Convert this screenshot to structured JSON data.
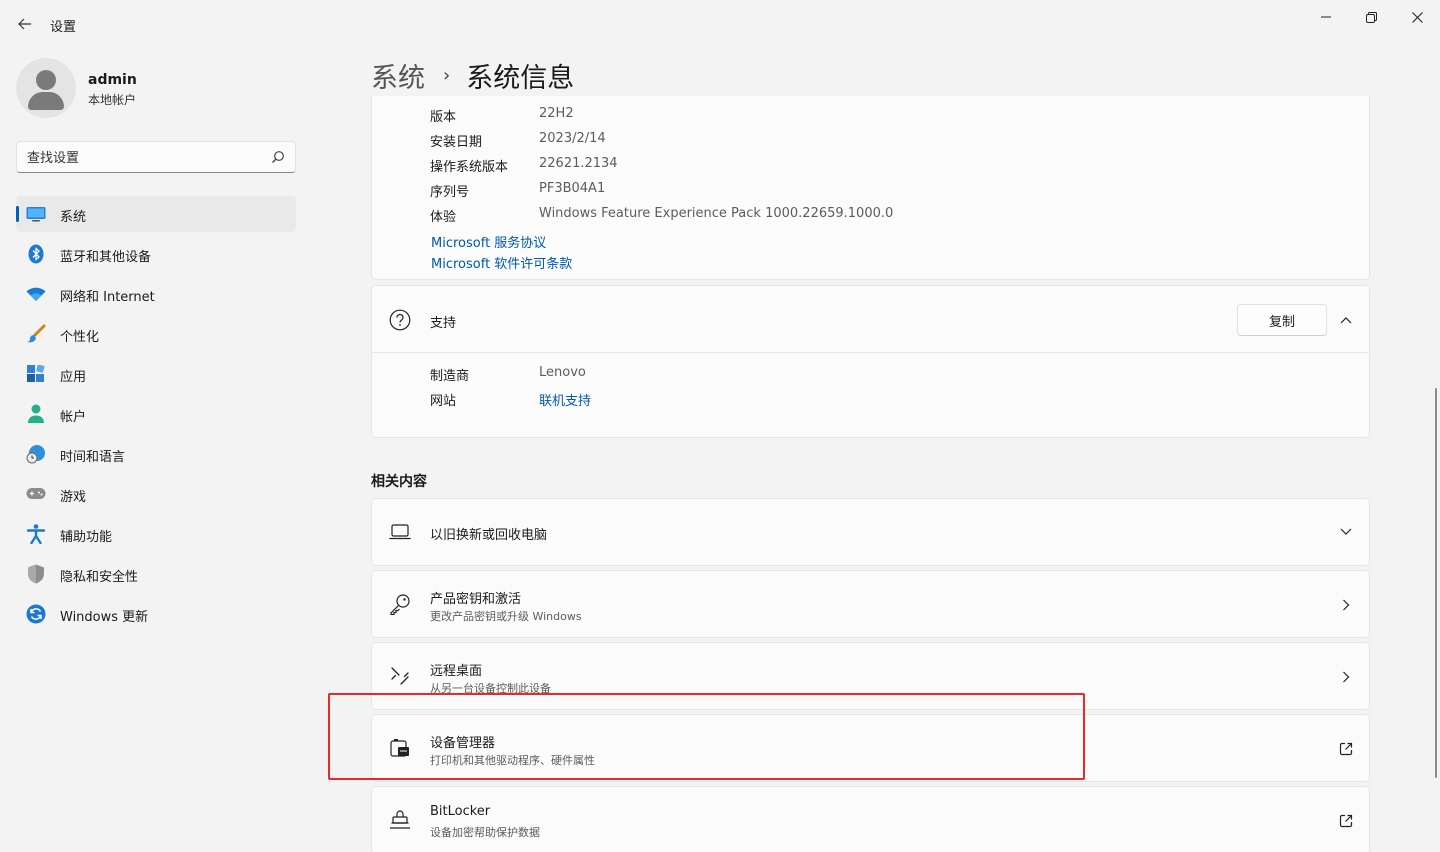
{
  "window": {
    "title": "设置",
    "back_icon": "arrow-left-icon",
    "minimize_icon": "minimize-icon",
    "maximize_icon": "restore-icon",
    "close_icon": "close-icon"
  },
  "profile": {
    "name": "admin",
    "account_type": "本地帐户"
  },
  "search": {
    "placeholder": "查找设置",
    "icon": "search-icon"
  },
  "sidebar": {
    "items": [
      {
        "label": "系统",
        "icon": "monitor-icon",
        "active": true
      },
      {
        "label": "蓝牙和其他设备",
        "icon": "bluetooth-icon"
      },
      {
        "label": "网络和 Internet",
        "icon": "wifi-icon"
      },
      {
        "label": "个性化",
        "icon": "paintbrush-icon"
      },
      {
        "label": "应用",
        "icon": "apps-icon"
      },
      {
        "label": "帐户",
        "icon": "person-icon"
      },
      {
        "label": "时间和语言",
        "icon": "globe-clock-icon"
      },
      {
        "label": "游戏",
        "icon": "gamepad-icon"
      },
      {
        "label": "辅助功能",
        "icon": "accessibility-icon"
      },
      {
        "label": "隐私和安全性",
        "icon": "shield-icon"
      },
      {
        "label": "Windows 更新",
        "icon": "update-icon"
      }
    ]
  },
  "breadcrumb": {
    "parent": "系统",
    "separator": "›",
    "current": "系统信息"
  },
  "windows_spec": {
    "rows": [
      {
        "key": "版本",
        "value": "22H2"
      },
      {
        "key": "安装日期",
        "value": "2023/2/14"
      },
      {
        "key": "操作系统版本",
        "value": "22621.2134"
      },
      {
        "key": "序列号",
        "value": "PF3B04A1"
      },
      {
        "key": "体验",
        "value": "Windows Feature Experience Pack 1000.22659.1000.0"
      }
    ],
    "links": [
      "Microsoft 服务协议",
      "Microsoft 软件许可条款"
    ]
  },
  "support": {
    "title": "支持",
    "icon": "help-circle-icon",
    "copy_label": "复制",
    "collapse_icon": "chevron-up-icon",
    "rows": [
      {
        "key": "制造商",
        "value": "Lenovo"
      },
      {
        "key": "网站",
        "value": "联机支持"
      }
    ]
  },
  "related": {
    "heading": "相关内容",
    "items": [
      {
        "title": "以旧换新或回收电脑",
        "subtitle": "",
        "icon": "laptop-icon",
        "action": "chevron-down-icon"
      },
      {
        "title": "产品密钥和激活",
        "subtitle": "更改产品密钥或升级 Windows",
        "icon": "key-icon",
        "action": "chevron-right-icon"
      },
      {
        "title": "远程桌面",
        "subtitle": "从另一台设备控制此设备",
        "icon": "remote-desktop-icon",
        "action": "chevron-right-icon"
      },
      {
        "title": "设备管理器",
        "subtitle": "打印机和其他驱动程序、硬件属性",
        "icon": "device-manager-icon",
        "action": "open-external-icon"
      },
      {
        "title": "BitLocker",
        "subtitle": "设备加密帮助保护数据",
        "icon": "bitlocker-icon",
        "action": "open-external-icon"
      }
    ]
  },
  "colors": {
    "accent": "#005fb8",
    "link": "#0058b0",
    "highlight": "#e8282b"
  }
}
